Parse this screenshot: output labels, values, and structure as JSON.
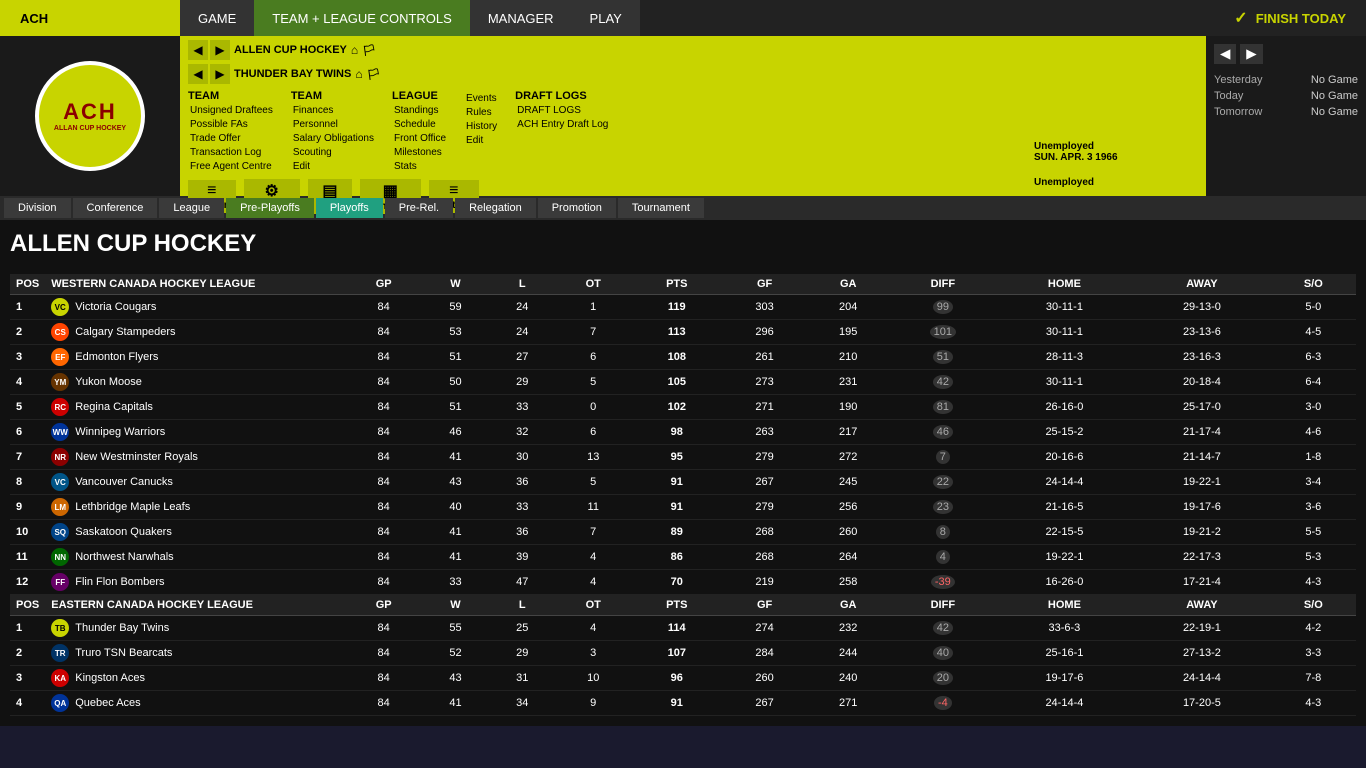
{
  "topbar": {
    "left_label": "ACH",
    "nav_buttons": [
      {
        "label": "GAME",
        "active": false
      },
      {
        "label": "TEAM + LEAGUE CONTROLS",
        "active": true
      },
      {
        "label": "MANAGER",
        "active": false
      },
      {
        "label": "PLAY",
        "active": false
      }
    ],
    "finish_today": "FINISH TODAY"
  },
  "logo": {
    "ach": "ACH",
    "sub": "ALLAN CUP HOCKEY"
  },
  "nav": {
    "team1": "ALLEN CUP HOCKEY",
    "team2": "THUNDER BAY TWINS",
    "team_menu": {
      "title": "TEAM",
      "items": [
        "Unsigned Draftees",
        "Possible FAs",
        "Trade Offer",
        "Transaction Log",
        "Free Agent Centre"
      ]
    },
    "finances_menu": {
      "title": "",
      "items": [
        "Finances",
        "Personnel",
        "Salary Obligations",
        "Scouting",
        "Edit"
      ]
    },
    "league_menu": {
      "title": "LEAGUE",
      "items": [
        "Standings",
        "Schedule",
        "Front Office",
        "Milestones",
        "Stats"
      ]
    },
    "events_menu": {
      "title": "",
      "items": [
        "Events",
        "Rules",
        "History",
        "Edit"
      ]
    },
    "draft_menu": {
      "title": "DRAFT LOGS",
      "items": [
        "ACH Entry Draft Log"
      ]
    },
    "icons": [
      {
        "label": "Roster",
        "symbol": "≡"
      },
      {
        "label": "Strategy",
        "symbol": "⚙"
      },
      {
        "label": "Depth",
        "symbol": "▤"
      },
      {
        "label": "Schedule",
        "symbol": "▦"
      },
      {
        "label": "History",
        "symbol": "≡"
      }
    ]
  },
  "manager": {
    "status": "Unemployed",
    "date": "SUN. APR. 3 1966",
    "name": "Unemployed"
  },
  "schedule": {
    "yesterday_label": "Yesterday",
    "yesterday_val": "No Game",
    "today_label": "Today",
    "today_val": "No Game",
    "tomorrow_label": "Tomorrow",
    "tomorrow_val": "No Game"
  },
  "sub_nav": {
    "tabs": [
      {
        "label": "Division",
        "active": false
      },
      {
        "label": "Conference",
        "active": false
      },
      {
        "label": "League",
        "active": false
      },
      {
        "label": "Pre-Playoffs",
        "active": true,
        "color": "green"
      },
      {
        "label": "Playoffs",
        "active": true,
        "color": "teal"
      },
      {
        "label": "Pre-Rel.",
        "active": false
      },
      {
        "label": "Relegation",
        "active": false
      },
      {
        "label": "Promotion",
        "active": false
      },
      {
        "label": "Tournament",
        "active": false
      }
    ]
  },
  "page_title": "ALLEN CUP HOCKEY",
  "columns": [
    "POS",
    "WESTERN CANADA HOCKEY LEAGUE",
    "GP",
    "W",
    "L",
    "OT",
    "PTS",
    "GF",
    "GA",
    "DIFF",
    "HOME",
    "AWAY",
    "S/O"
  ],
  "western_division": {
    "name": "WESTERN CANADA HOCKEY LEAGUE",
    "teams": [
      {
        "pos": 1,
        "name": "Victoria Cougars",
        "logo_class": "logo-vc",
        "logo_text": "VC",
        "gp": 84,
        "w": 59,
        "l": 24,
        "ot": 1,
        "pts": 119,
        "gf": 303,
        "ga": 204,
        "diff": 99,
        "home": "30-11-1",
        "away": "29-13-0",
        "so": "5-0"
      },
      {
        "pos": 2,
        "name": "Calgary Stampeders",
        "logo_class": "logo-cs",
        "logo_text": "CS",
        "gp": 84,
        "w": 53,
        "l": 24,
        "ot": 7,
        "pts": 113,
        "gf": 296,
        "ga": 195,
        "diff": 101,
        "home": "30-11-1",
        "away": "23-13-6",
        "so": "4-5"
      },
      {
        "pos": 3,
        "name": "Edmonton Flyers",
        "logo_class": "logo-ef",
        "logo_text": "EF",
        "gp": 84,
        "w": 51,
        "l": 27,
        "ot": 6,
        "pts": 108,
        "gf": 261,
        "ga": 210,
        "diff": 51,
        "home": "28-11-3",
        "away": "23-16-3",
        "so": "6-3"
      },
      {
        "pos": 4,
        "name": "Yukon Moose",
        "logo_class": "logo-ym",
        "logo_text": "YM",
        "gp": 84,
        "w": 50,
        "l": 29,
        "ot": 5,
        "pts": 105,
        "gf": 273,
        "ga": 231,
        "diff": 42,
        "home": "30-11-1",
        "away": "20-18-4",
        "so": "6-4"
      },
      {
        "pos": 5,
        "name": "Regina Capitals",
        "logo_class": "logo-rc",
        "logo_text": "RC",
        "gp": 84,
        "w": 51,
        "l": 33,
        "ot": 0,
        "pts": 102,
        "gf": 271,
        "ga": 190,
        "diff": 81,
        "home": "26-16-0",
        "away": "25-17-0",
        "so": "3-0"
      },
      {
        "pos": 6,
        "name": "Winnipeg Warriors",
        "logo_class": "logo-ww",
        "logo_text": "WW",
        "gp": 84,
        "w": 46,
        "l": 32,
        "ot": 6,
        "pts": 98,
        "gf": 263,
        "ga": 217,
        "diff": 46,
        "home": "25-15-2",
        "away": "21-17-4",
        "so": "4-6"
      },
      {
        "pos": 7,
        "name": "New Westminster Royals",
        "logo_class": "logo-nwr",
        "logo_text": "NR",
        "gp": 84,
        "w": 41,
        "l": 30,
        "ot": 13,
        "pts": 95,
        "gf": 279,
        "ga": 272,
        "diff": 7,
        "home": "20-16-6",
        "away": "21-14-7",
        "so": "1-8"
      },
      {
        "pos": 8,
        "name": "Vancouver Canucks",
        "logo_class": "logo-vc2",
        "logo_text": "VC",
        "gp": 84,
        "w": 43,
        "l": 36,
        "ot": 5,
        "pts": 91,
        "gf": 267,
        "ga": 245,
        "diff": 22,
        "home": "24-14-4",
        "away": "19-22-1",
        "so": "3-4"
      },
      {
        "pos": 9,
        "name": "Lethbridge Maple Leafs",
        "logo_class": "logo-lml",
        "logo_text": "LM",
        "gp": 84,
        "w": 40,
        "l": 33,
        "ot": 11,
        "pts": 91,
        "gf": 279,
        "ga": 256,
        "diff": 23,
        "home": "21-16-5",
        "away": "19-17-6",
        "so": "3-6"
      },
      {
        "pos": 10,
        "name": "Saskatoon Quakers",
        "logo_class": "logo-sq",
        "logo_text": "SQ",
        "gp": 84,
        "w": 41,
        "l": 36,
        "ot": 7,
        "pts": 89,
        "gf": 268,
        "ga": 260,
        "diff": 8,
        "home": "22-15-5",
        "away": "19-21-2",
        "so": "5-5"
      },
      {
        "pos": 11,
        "name": "Northwest Narwhals",
        "logo_class": "logo-nn",
        "logo_text": "NN",
        "gp": 84,
        "w": 41,
        "l": 39,
        "ot": 4,
        "pts": 86,
        "gf": 268,
        "ga": 264,
        "diff": 4,
        "home": "19-22-1",
        "away": "22-17-3",
        "so": "5-3"
      },
      {
        "pos": 12,
        "name": "Flin Flon Bombers",
        "logo_class": "logo-ffb",
        "logo_text": "FF",
        "gp": 84,
        "w": 33,
        "l": 47,
        "ot": 4,
        "pts": 70,
        "gf": 219,
        "ga": 258,
        "diff": -39,
        "home": "16-26-0",
        "away": "17-21-4",
        "so": "4-3"
      }
    ]
  },
  "eastern_division": {
    "name": "EASTERN CANADA HOCKEY LEAGUE",
    "teams": [
      {
        "pos": 1,
        "name": "Thunder Bay Twins",
        "logo_class": "logo-tbt",
        "logo_text": "TB",
        "gp": 84,
        "w": 55,
        "l": 25,
        "ot": 4,
        "pts": 114,
        "gf": 274,
        "ga": 232,
        "diff": 42,
        "home": "33-6-3",
        "away": "22-19-1",
        "so": "4-2"
      },
      {
        "pos": 2,
        "name": "Truro TSN Bearcats",
        "logo_class": "logo-truro",
        "logo_text": "TR",
        "gp": 84,
        "w": 52,
        "l": 29,
        "ot": 3,
        "pts": 107,
        "gf": 284,
        "ga": 244,
        "diff": 40,
        "home": "25-16-1",
        "away": "27-13-2",
        "so": "3-3"
      },
      {
        "pos": 3,
        "name": "Kingston Aces",
        "logo_class": "logo-ka",
        "logo_text": "KA",
        "gp": 84,
        "w": 43,
        "l": 31,
        "ot": 10,
        "pts": 96,
        "gf": 260,
        "ga": 240,
        "diff": 20,
        "home": "19-17-6",
        "away": "24-14-4",
        "so": "7-8"
      },
      {
        "pos": 4,
        "name": "Quebec Aces",
        "logo_class": "logo-qa",
        "logo_text": "QA",
        "gp": 84,
        "w": 41,
        "l": 34,
        "ot": 9,
        "pts": 91,
        "gf": 267,
        "ga": 271,
        "diff": -4,
        "home": "24-14-4",
        "away": "17-20-5",
        "so": "4-3"
      }
    ]
  }
}
